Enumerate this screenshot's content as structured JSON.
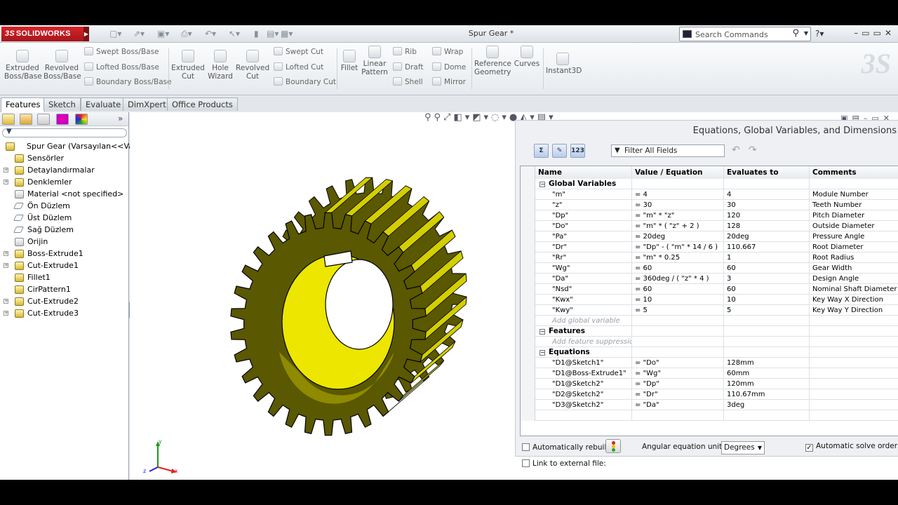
{
  "titlebar": {
    "logo": "SOLIDWORKS",
    "logo_prefix": "3S",
    "document_title": "Spur Gear *",
    "search_placeholder": "Search Commands"
  },
  "commands": {
    "extruded_boss": "Extruded Boss/Base",
    "revolved_boss": "Revolved Boss/Base",
    "swept_boss": "Swept Boss/Base",
    "lofted_boss": "Lofted Boss/Base",
    "boundary_boss": "Boundary Boss/Base",
    "extruded_cut": "Extruded Cut",
    "hole_wizard": "Hole Wizard",
    "revolved_cut": "Revolved Cut",
    "swept_cut": "Swept Cut",
    "lofted_cut": "Lofted Cut",
    "boundary_cut": "Boundary Cut",
    "fillet": "Fillet",
    "linear_pattern": "Linear Pattern",
    "rib": "Rib",
    "draft": "Draft",
    "shell": "Shell",
    "wrap": "Wrap",
    "dome": "Dome",
    "mirror": "Mirror",
    "reference_geometry": "Reference Geometry",
    "curves": "Curves",
    "instant3d": "Instant3D"
  },
  "tabs": [
    "Features",
    "Sketch",
    "Evaluate",
    "DimXpert",
    "Office Products"
  ],
  "tree": {
    "root": "Spur Gear  (Varsayılan<<Varsa",
    "items": [
      {
        "label": "Sensörler",
        "expand": false
      },
      {
        "label": "Detaylandırmalar",
        "expand": true
      },
      {
        "label": "Denklemler",
        "expand": true
      },
      {
        "label": "Material <not specified>",
        "expand": false
      },
      {
        "label": "Ön Düzlem",
        "expand": false
      },
      {
        "label": "Üst Düzlem",
        "expand": false
      },
      {
        "label": "Sağ Düzlem",
        "expand": false
      },
      {
        "label": "Orijin",
        "expand": false
      },
      {
        "label": "Boss-Extrude1",
        "expand": true
      },
      {
        "label": "Cut-Extrude1",
        "expand": true
      },
      {
        "label": "Fillet1",
        "expand": false
      },
      {
        "label": "CirPattern1",
        "expand": false
      },
      {
        "label": "Cut-Extrude2",
        "expand": true
      },
      {
        "label": "Cut-Extrude3",
        "expand": true
      }
    ]
  },
  "equations": {
    "title": "Equations, Global Variables, and Dimensions",
    "filter": "Filter All Fields",
    "headers": {
      "name": "Name",
      "value": "Value / Equation",
      "evaluates": "Evaluates to",
      "comments": "Comments"
    },
    "sections": {
      "global": "Global Variables",
      "features": "Features",
      "equations": "Equations"
    },
    "add_global": "Add global variable",
    "add_feature": "Add feature suppression",
    "globals": [
      {
        "name": "\"m\"",
        "value": "= 4",
        "eval": "4",
        "comment": "Module Number"
      },
      {
        "name": "\"z\"",
        "value": "= 30",
        "eval": "30",
        "comment": "Teeth Number"
      },
      {
        "name": "\"Dp\"",
        "value": "= \"m\" * \"z\"",
        "eval": "120",
        "comment": "Pitch Diameter"
      },
      {
        "name": "\"Do\"",
        "value": "= \"m\" * ( \"z\" + 2 )",
        "eval": "128",
        "comment": "Outside Diameter"
      },
      {
        "name": "\"Pa\"",
        "value": "= 20deg",
        "eval": "20deg",
        "comment": "Pressure Angle"
      },
      {
        "name": "\"Dr\"",
        "value": "= \"Dp\" - ( \"m\" * 14 / 6 )",
        "eval": "110.667",
        "comment": "Root Diameter"
      },
      {
        "name": "\"Rr\"",
        "value": "= \"m\" * 0.25",
        "eval": "1",
        "comment": "Root Radius"
      },
      {
        "name": "\"Wg\"",
        "value": "= 60",
        "eval": "60",
        "comment": "Gear Width"
      },
      {
        "name": "\"Da\"",
        "value": "= 360deg / ( \"z\" * 4 )",
        "eval": "3",
        "comment": "Design Angle"
      },
      {
        "name": "\"Nsd\"",
        "value": "= 60",
        "eval": "60",
        "comment": "Nominal Shaft Diameter"
      },
      {
        "name": "\"Kwx\"",
        "value": "= 10",
        "eval": "10",
        "comment": "Key Way X Direction"
      },
      {
        "name": "\"Kwy\"",
        "value": "= 5",
        "eval": "5",
        "comment": "Key Way Y Direction"
      }
    ],
    "eqs": [
      {
        "name": "\"D1@Sketch1\"",
        "value": "= \"Do\"",
        "eval": "128mm",
        "comment": ""
      },
      {
        "name": "\"D1@Boss-Extrude1\"",
        "value": "= \"Wg\"",
        "eval": "60mm",
        "comment": ""
      },
      {
        "name": "\"D1@Sketch2\"",
        "value": "= \"Dp\"",
        "eval": "120mm",
        "comment": ""
      },
      {
        "name": "\"D2@Sketch2\"",
        "value": "= \"Dr\"",
        "eval": "110.67mm",
        "comment": ""
      },
      {
        "name": "\"D3@Sketch2\"",
        "value": "= \"Da\"",
        "eval": "3deg",
        "comment": ""
      }
    ],
    "footer": {
      "auto_rebuild": "Automatically rebuild",
      "link_external": "Link to external file:",
      "angular_units_label": "Angular equation units:",
      "angular_units_value": "Degrees",
      "auto_solve": "Automatic solve order"
    }
  },
  "colors": {
    "accent": "#d8232a",
    "gear": "#d4cf00",
    "gear_dark": "#5a5800"
  }
}
